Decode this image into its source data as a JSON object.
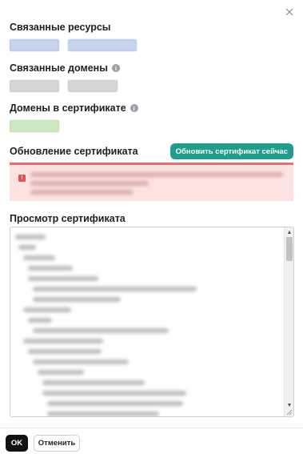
{
  "dialog": {
    "close_icon": "close-icon"
  },
  "linked_resources": {
    "title": "Связанные ресурсы"
  },
  "linked_domains": {
    "title": "Связанные домены",
    "info_icon": "info-icon"
  },
  "cert_domains": {
    "title": "Домены в сертификате",
    "info_icon": "info-icon"
  },
  "update": {
    "title": "Обновление сертификата",
    "renew_label": "Обновить сертификат сейчас",
    "alert_icon": "alert-icon",
    "alert_icon_glyph": "!"
  },
  "preview": {
    "title": "Просмотр сертификата"
  },
  "footer": {
    "ok_label": "OK",
    "cancel_label": "Отменить"
  },
  "colors": {
    "accent": "#1f9e8b",
    "alert_background": "#fde2e2",
    "alert_border": "#ee6d6d",
    "primary_button": "#111111"
  }
}
